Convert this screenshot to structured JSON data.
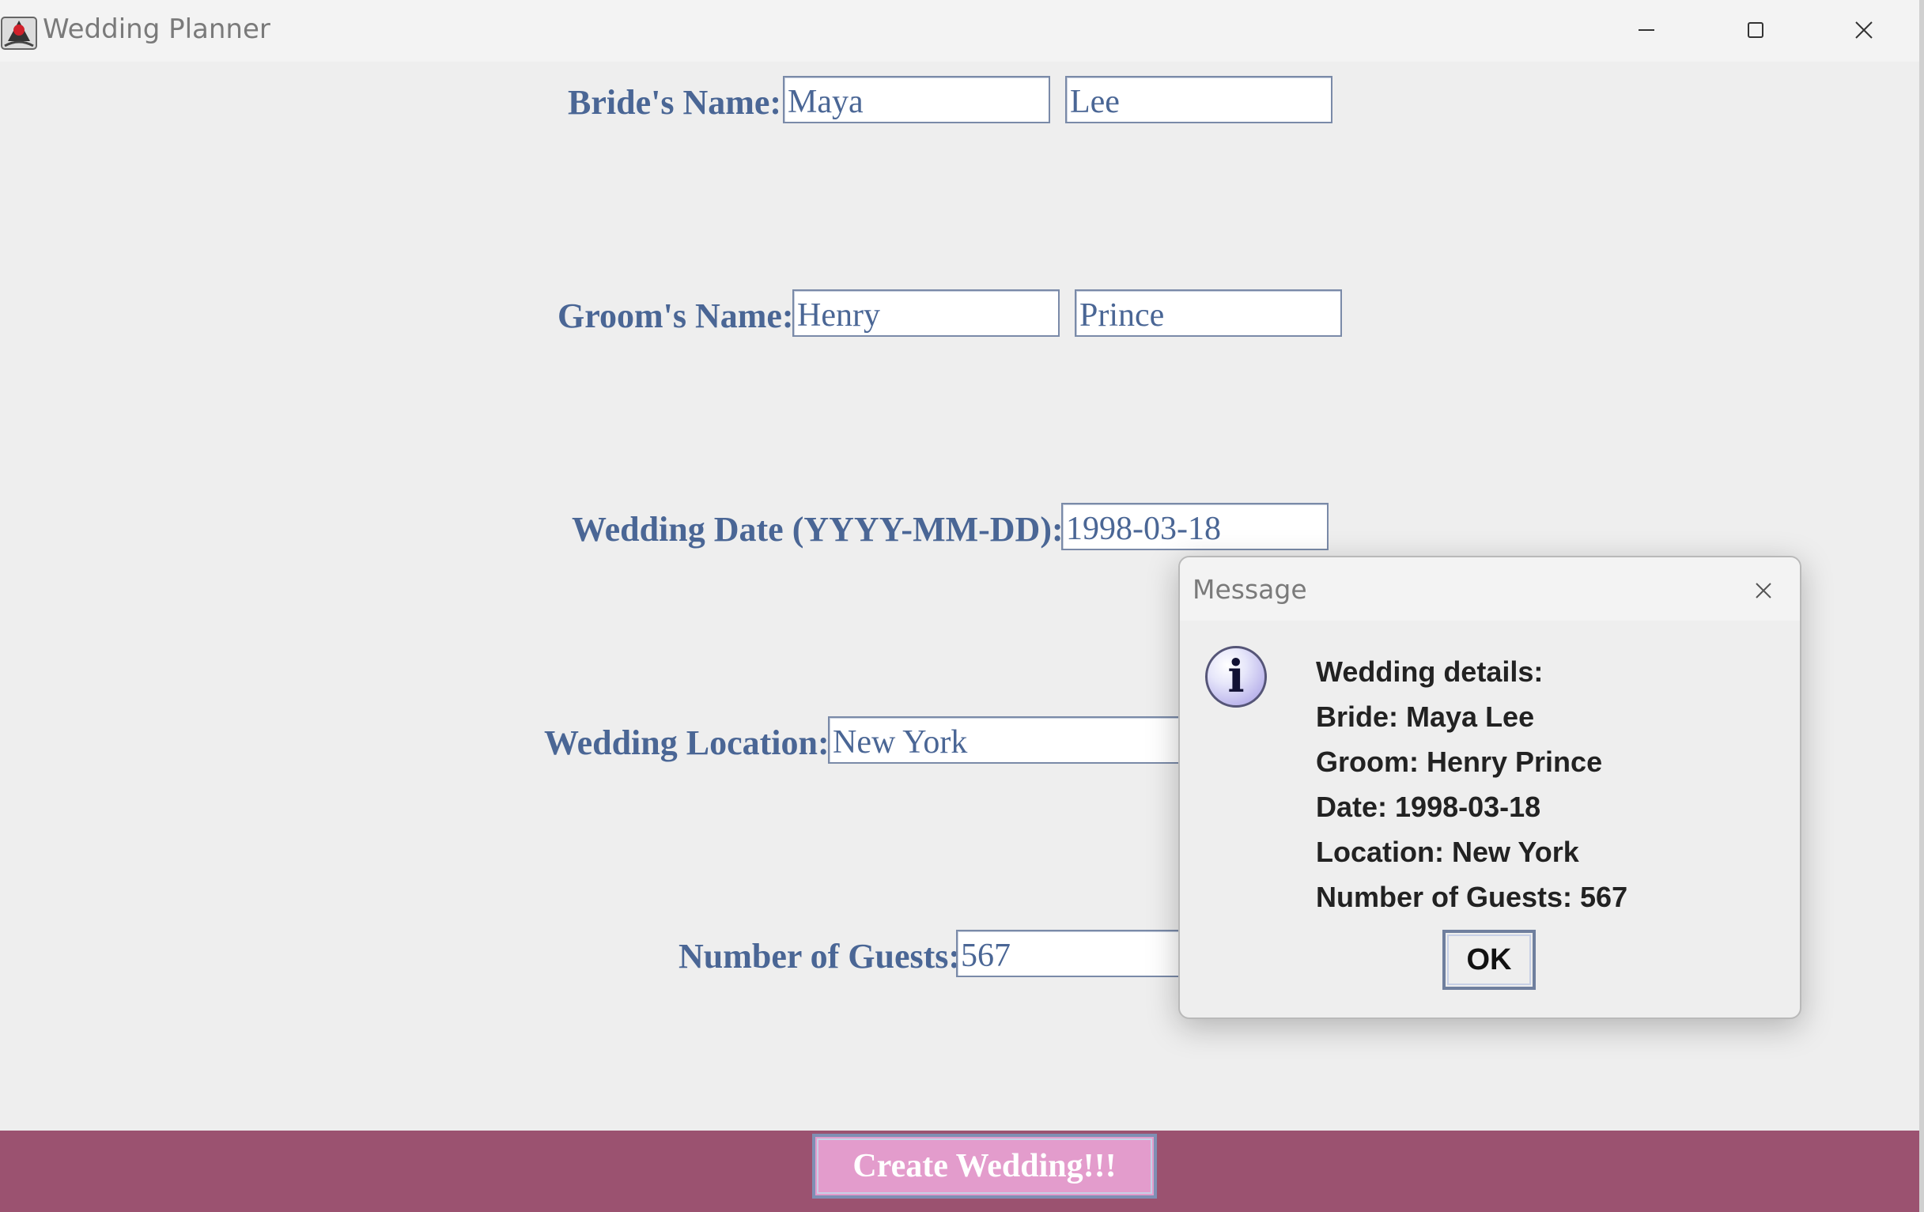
{
  "window": {
    "title": "Wedding Planner"
  },
  "form": {
    "bride": {
      "label": "Bride's Name:",
      "first": "Maya",
      "last": "Lee"
    },
    "groom": {
      "label": "Groom's Name:",
      "first": "Henry",
      "last": "Prince"
    },
    "date": {
      "label": "Wedding Date (YYYY-MM-DD):",
      "value": "1998-03-18"
    },
    "location": {
      "label": "Wedding Location:",
      "value": "New York"
    },
    "guests": {
      "label": "Number of Guests:",
      "value": "567"
    },
    "create_label": "Create Wedding!!!"
  },
  "dialog": {
    "title": "Message",
    "icon": "info-icon",
    "lines": [
      "Wedding details:",
      "Bride: Maya Lee",
      "Groom: Henry Prince",
      "Date: 1998-03-18",
      "Location: New York",
      "Number of Guests: 567"
    ],
    "ok_label": "OK"
  },
  "colors": {
    "label": "#4a6695",
    "bottom_bar": "#9b5270",
    "create_button": "#e39ccc",
    "background": "#eeeeee"
  }
}
